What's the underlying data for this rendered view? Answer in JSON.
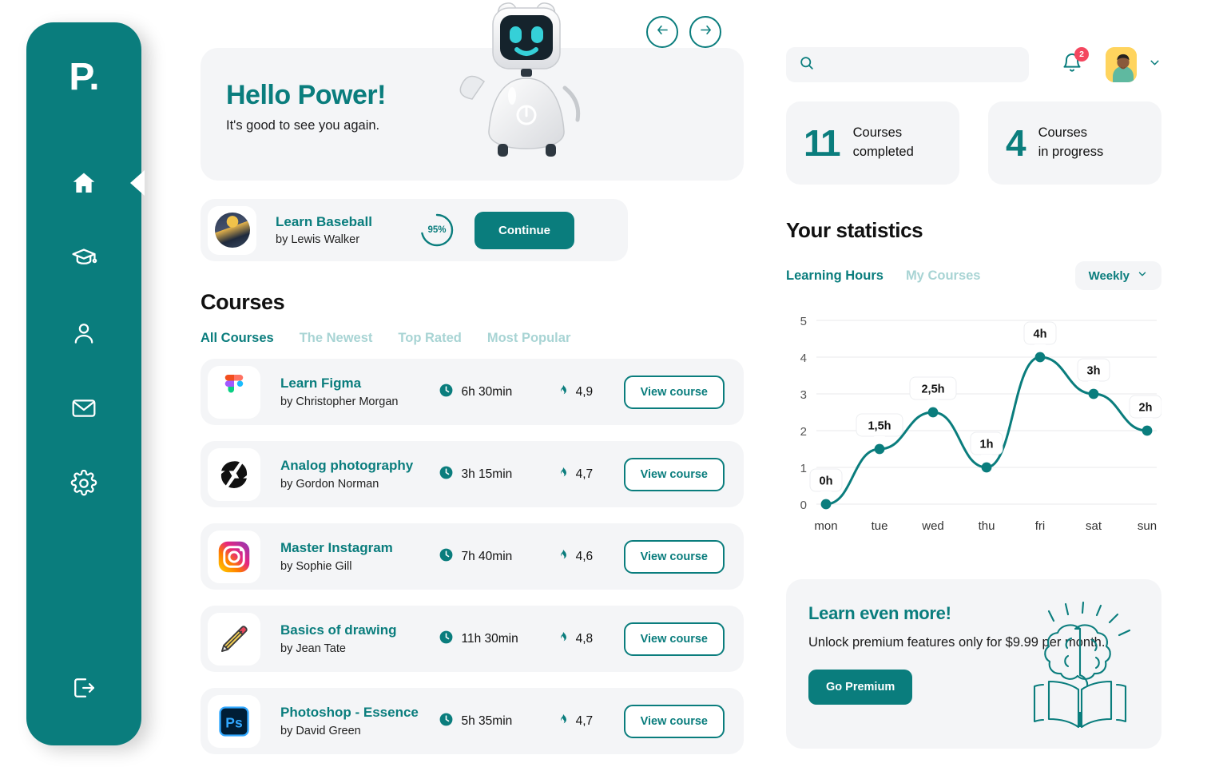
{
  "brand": {
    "logo": "P.",
    "accent": "#0a7d7d",
    "card_bg": "#f4f5f7",
    "badge_color": "#f4475f"
  },
  "sidebar": {
    "items": [
      {
        "name": "home",
        "icon": "home-icon",
        "active": true
      },
      {
        "name": "courses",
        "icon": "graduation-cap-icon",
        "active": false
      },
      {
        "name": "profile",
        "icon": "user-icon",
        "active": false
      },
      {
        "name": "messages",
        "icon": "mail-icon",
        "active": false
      },
      {
        "name": "settings",
        "icon": "gear-icon",
        "active": false
      }
    ],
    "logout": {
      "name": "logout",
      "icon": "logout-icon"
    }
  },
  "hero": {
    "greeting": "Hello Power!",
    "subtitle": "It's good to see you again.",
    "illustration": "robot-illustration"
  },
  "continue_card": {
    "title": "Learn Baseball",
    "author": "by Lewis Walker",
    "progress_label": "95%",
    "progress_value": 95,
    "button": "Continue",
    "prev_icon": "arrow-left-icon",
    "next_icon": "arrow-right-icon"
  },
  "courses_section": {
    "heading": "Courses",
    "tabs": [
      {
        "label": "All Courses",
        "active": true
      },
      {
        "label": "The Newest",
        "active": false
      },
      {
        "label": "Top Rated",
        "active": false
      },
      {
        "label": "Most Popular",
        "active": false
      }
    ],
    "view_label": "View course",
    "items": [
      {
        "title": "Learn Figma",
        "author": "by Christopher Morgan",
        "duration": "6h 30min",
        "rating": "4,9",
        "icon": "figma-icon"
      },
      {
        "title": "Analog photography",
        "author": "by Gordon Norman",
        "duration": "3h 15min",
        "rating": "4,7",
        "icon": "aperture-icon"
      },
      {
        "title": "Master Instagram",
        "author": "by Sophie Gill",
        "duration": "7h 40min",
        "rating": "4,6",
        "icon": "instagram-icon"
      },
      {
        "title": "Basics of drawing",
        "author": "by Jean Tate",
        "duration": "11h 30min",
        "rating": "4,8",
        "icon": "pencil-icon"
      },
      {
        "title": "Photoshop - Essence",
        "author": "by David Green",
        "duration": "5h 35min",
        "rating": "4,7",
        "icon": "photoshop-icon"
      }
    ]
  },
  "topbar": {
    "search_placeholder": "",
    "search_value": "",
    "search_icon": "search-icon",
    "bell_icon": "bell-icon",
    "notification_count": "2",
    "avatar": "user-avatar",
    "chevron": "chevron-down-icon"
  },
  "stats_cards": [
    {
      "number": "11",
      "label_line1": "Courses",
      "label_line2": "completed"
    },
    {
      "number": "4",
      "label_line1": "Courses",
      "label_line2": "in progress"
    }
  ],
  "statistics": {
    "heading": "Your statistics",
    "tabs": [
      {
        "label": "Learning Hours",
        "active": true
      },
      {
        "label": "My Courses",
        "active": false
      }
    ],
    "range_selector": {
      "label": "Weekly",
      "icon": "chevron-down-icon"
    }
  },
  "chart_data": {
    "type": "line",
    "title": "Your statistics",
    "subtitle": "Learning Hours",
    "xlabel": "",
    "ylabel": "",
    "categories": [
      "mon",
      "tue",
      "wed",
      "thu",
      "fri",
      "sat",
      "sun"
    ],
    "values": [
      0,
      1.5,
      2.5,
      1,
      4,
      3,
      2
    ],
    "point_labels": [
      "0h",
      "1,5h",
      "2,5h",
      "1h",
      "4h",
      "3h",
      "2h"
    ],
    "ytick_labels": [
      "0",
      "1",
      "2",
      "3",
      "4",
      "5"
    ],
    "ylim": [
      0,
      5
    ],
    "grid": true,
    "legend": "none",
    "line_color": "#0a7d7d",
    "smooth": true
  },
  "promo": {
    "title": "Learn even more!",
    "text": "Unlock premium features only for $9.99 per month.",
    "button": "Go Premium",
    "illustration": "brain-book-icon"
  }
}
